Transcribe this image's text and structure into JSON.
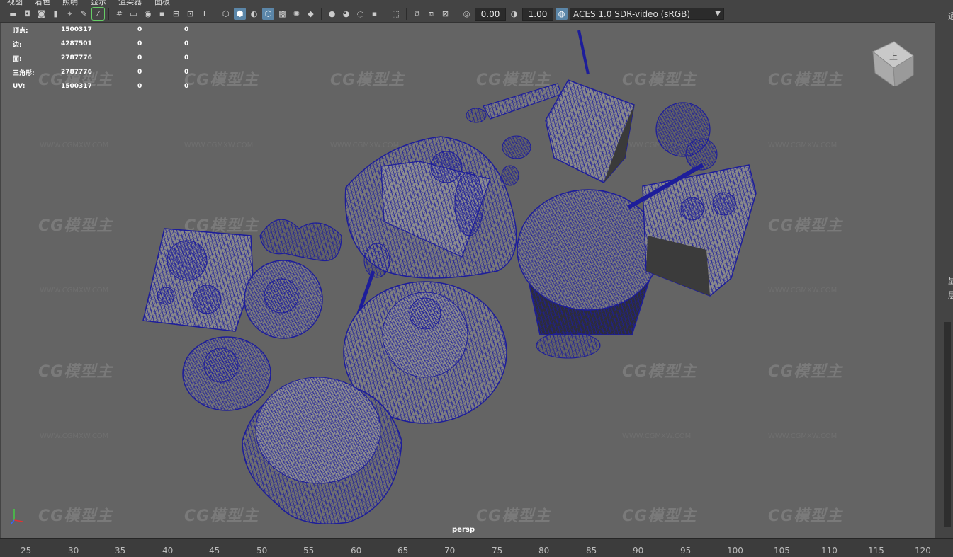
{
  "menu": [
    "视图",
    "着色",
    "照明",
    "显示",
    "渲染器",
    "面板"
  ],
  "toolbar": {
    "exposure_value": "0.00",
    "gamma_value": "1.00",
    "color_space": "ACES 1.0 SDR-video (sRGB)"
  },
  "hud": {
    "rows": [
      {
        "label": "顶点:",
        "v1": "1500317",
        "v2": "0",
        "v3": "0"
      },
      {
        "label": "边:",
        "v1": "4287501",
        "v2": "0",
        "v3": "0"
      },
      {
        "label": "面:",
        "v1": "2787776",
        "v2": "0",
        "v3": "0"
      },
      {
        "label": "三角形:",
        "v1": "2787776",
        "v2": "0",
        "v3": "0"
      },
      {
        "label": "UV:",
        "v1": "1500317",
        "v2": "0",
        "v3": "0"
      }
    ]
  },
  "viewport": {
    "camera_label": "persp",
    "view_cube_label": "上",
    "watermark_text": "CG模型主",
    "watermark_url": "WWW.CGMXW.COM"
  },
  "right_panel": [
    "通",
    "显",
    "层"
  ],
  "timeline": [
    "25",
    "30",
    "35",
    "40",
    "45",
    "50",
    "55",
    "60",
    "65",
    "70",
    "75",
    "80",
    "85",
    "90",
    "95",
    "100",
    "105",
    "110",
    "115",
    "120"
  ],
  "colors": {
    "wire": "#1d1d9a",
    "viewport_bg": "#646464",
    "toolbar_bg": "#444444"
  }
}
